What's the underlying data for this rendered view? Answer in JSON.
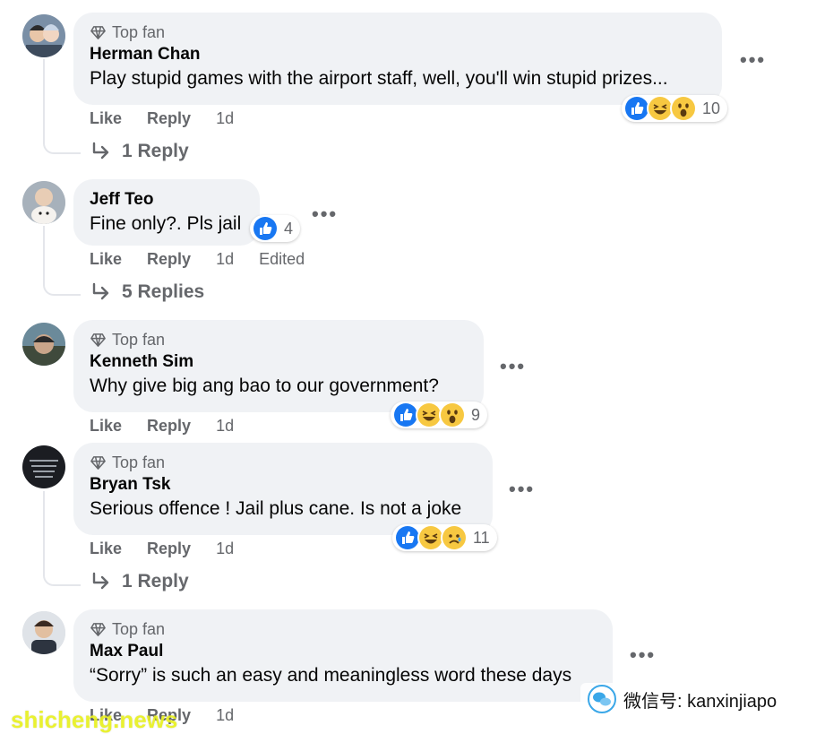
{
  "comments": [
    {
      "badge": "Top fan",
      "author": "Herman Chan",
      "text": "Play stupid games with the airport staff, well, you'll win stupid prizes...",
      "like": "Like",
      "reply": "Reply",
      "time": "1d",
      "reaction_count": "10",
      "reactions": [
        "like-reaction-icon",
        "haha-reaction-icon",
        "wow-reaction-icon"
      ],
      "replies": "1 Reply"
    },
    {
      "author": "Jeff Teo",
      "text": "Fine only?. Pls jail",
      "like": "Like",
      "reply": "Reply",
      "time": "1d",
      "edited": "Edited",
      "reaction_count": "4",
      "reactions": [
        "like-reaction-icon"
      ],
      "replies": "5 Replies"
    },
    {
      "badge": "Top fan",
      "author": "Kenneth Sim",
      "text": "Why give big ang bao to our government?",
      "like": "Like",
      "reply": "Reply",
      "time": "1d",
      "reaction_count": "9",
      "reactions": [
        "like-reaction-icon",
        "haha-reaction-icon",
        "wow-reaction-icon"
      ]
    },
    {
      "badge": "Top fan",
      "author": "Bryan Tsk",
      "text": "Serious offence ! Jail plus cane. Is not a joke",
      "like": "Like",
      "reply": "Reply",
      "time": "1d",
      "reaction_count": "11",
      "reactions": [
        "like-reaction-icon",
        "haha-reaction-icon",
        "sad-reaction-icon"
      ],
      "replies": "1 Reply"
    },
    {
      "badge": "Top fan",
      "author": "Max Paul",
      "text": "“Sorry” is such an easy and meaningless word these days",
      "like": "Like",
      "reply": "Reply",
      "time": "1d"
    }
  ],
  "more_label": "•••",
  "colors": {
    "bubble": "#f0f2f5",
    "meta": "#65676b",
    "like_blue": "#1877f2",
    "emoji_yellow": "#f7c841"
  },
  "watermarks": {
    "site": "shicheng.news",
    "wechat": "微信号: kanxinjiapo"
  }
}
